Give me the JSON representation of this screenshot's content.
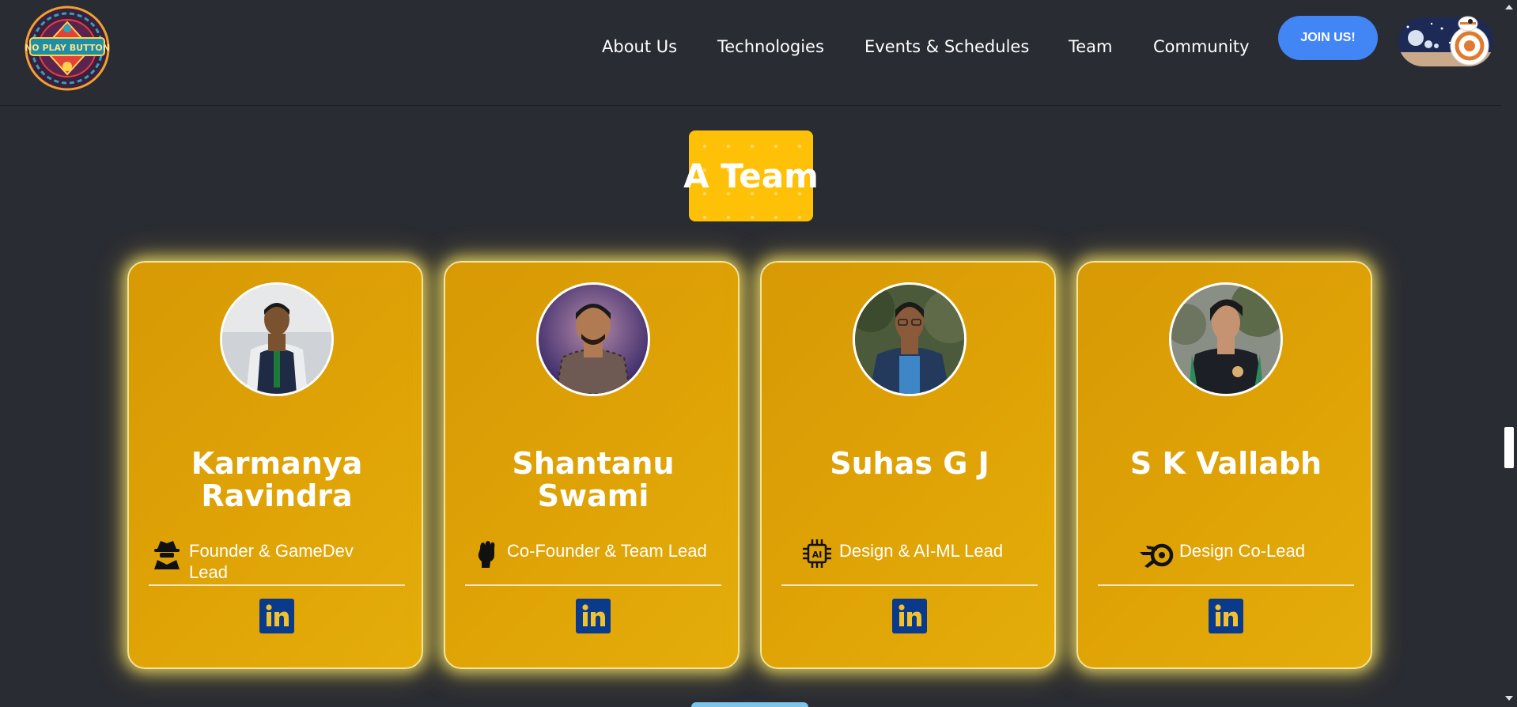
{
  "header": {
    "logo_text": "NO PLAY BUTTON",
    "nav": [
      "About Us",
      "Technologies",
      "Events & Schedules",
      "Team",
      "Community"
    ],
    "join_label": "JOIN US!",
    "theme_toggle_icon": "space-theme-toggle-icon"
  },
  "section": {
    "title": "A Team"
  },
  "team": [
    {
      "name": "Karmanya Ravindra",
      "role": "Founder & GameDev Lead",
      "role_icon": "spy-icon",
      "link_icon": "linkedin-icon"
    },
    {
      "name": "Shantanu Swami",
      "role": "Co-Founder & Team Lead",
      "role_icon": "raised-fist-icon",
      "link_icon": "linkedin-icon"
    },
    {
      "name": "Suhas G J",
      "role": "Design & AI-ML Lead",
      "role_icon": "ai-chip-icon",
      "link_icon": "linkedin-icon"
    },
    {
      "name": "S K Vallabh",
      "role": "Design Co-Lead",
      "role_icon": "blender-icon",
      "link_icon": "linkedin-icon"
    }
  ],
  "colors": {
    "background": "#2a2c33",
    "accent_yellow": "#ffc107",
    "card_gold": "#dfa306",
    "join_blue": "#4285f4",
    "linkedin_blue": "#0a3a8c"
  }
}
